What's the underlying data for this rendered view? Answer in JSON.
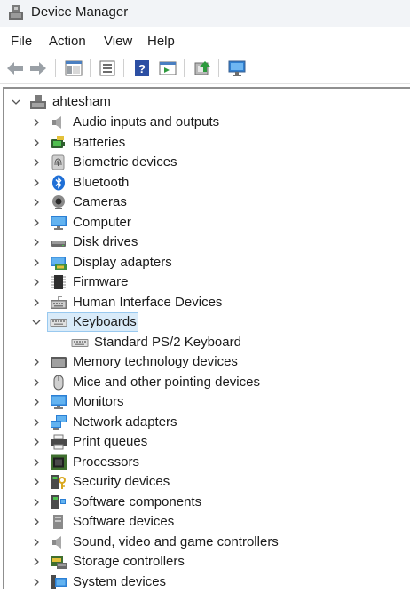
{
  "window": {
    "title": "Device Manager"
  },
  "menu": [
    "File",
    "Action",
    "View",
    "Help"
  ],
  "toolbar": [
    "back-arrow-icon",
    "forward-arrow-icon",
    "show-hide-tree-icon",
    "properties-icon",
    "help-icon",
    "action-icon",
    "update-driver-icon",
    "scan-hardware-icon"
  ],
  "tree": {
    "root": "ahtesham",
    "categories": [
      {
        "label": "Audio inputs and outputs",
        "icon": "speaker-icon"
      },
      {
        "label": "Batteries",
        "icon": "battery-icon"
      },
      {
        "label": "Biometric devices",
        "icon": "fingerprint-icon"
      },
      {
        "label": "Bluetooth",
        "icon": "bluetooth-icon"
      },
      {
        "label": "Cameras",
        "icon": "camera-icon"
      },
      {
        "label": "Computer",
        "icon": "computer-icon"
      },
      {
        "label": "Disk drives",
        "icon": "disk-drive-icon"
      },
      {
        "label": "Display adapters",
        "icon": "display-adapter-icon"
      },
      {
        "label": "Firmware",
        "icon": "firmware-chip-icon"
      },
      {
        "label": "Human Interface Devices",
        "icon": "hid-icon"
      },
      {
        "label": "Keyboards",
        "icon": "keyboard-icon",
        "expanded": true,
        "selected": true,
        "children": [
          "Standard PS/2 Keyboard"
        ]
      },
      {
        "label": "Memory technology devices",
        "icon": "memory-card-icon"
      },
      {
        "label": "Mice and other pointing devices",
        "icon": "mouse-icon"
      },
      {
        "label": "Monitors",
        "icon": "monitor-icon"
      },
      {
        "label": "Network adapters",
        "icon": "network-icon"
      },
      {
        "label": "Print queues",
        "icon": "printer-icon"
      },
      {
        "label": "Processors",
        "icon": "processor-icon"
      },
      {
        "label": "Security devices",
        "icon": "security-key-icon"
      },
      {
        "label": "Software components",
        "icon": "software-component-icon"
      },
      {
        "label": "Software devices",
        "icon": "software-device-icon"
      },
      {
        "label": "Sound, video and game controllers",
        "icon": "sound-controller-icon"
      },
      {
        "label": "Storage controllers",
        "icon": "storage-controller-icon"
      },
      {
        "label": "System devices",
        "icon": "system-devices-icon"
      }
    ]
  }
}
